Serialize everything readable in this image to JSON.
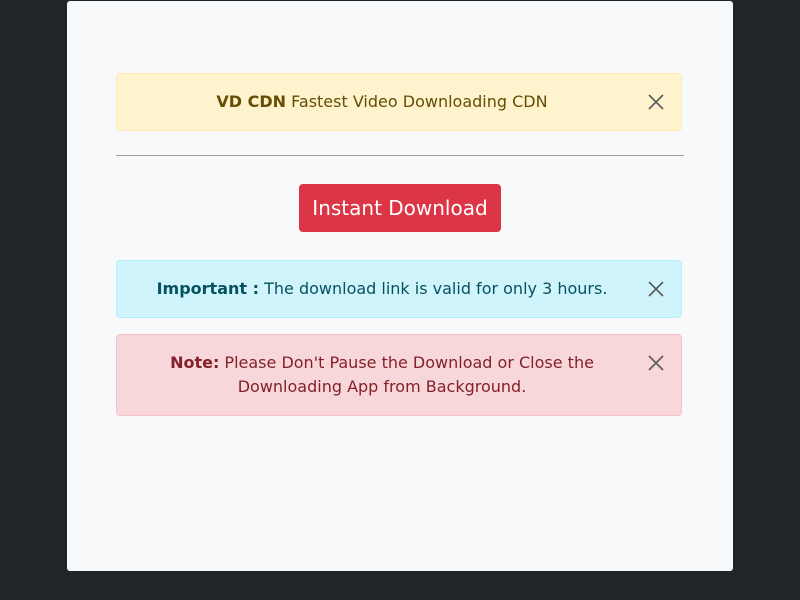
{
  "banner": {
    "brand": "VD CDN",
    "text": " Fastest Video Downloading CDN",
    "close_icon": "close-icon"
  },
  "download_button": {
    "label": "Instant Download"
  },
  "info_alert": {
    "label": "Important :",
    "text": " The download link is valid for only 3 hours.",
    "close_icon": "close-icon"
  },
  "danger_alert": {
    "label": "Note:",
    "text": " Please Don't Pause the Download or Close the Downloading App from Background.",
    "close_icon": "close-icon"
  },
  "colors": {
    "page_background": "#212529",
    "card_background": "#f8f9fa",
    "warning_background": "#fff3cd",
    "info_background": "#cff4fc",
    "danger_background": "#f8d7da",
    "button_background": "#dc3545"
  }
}
